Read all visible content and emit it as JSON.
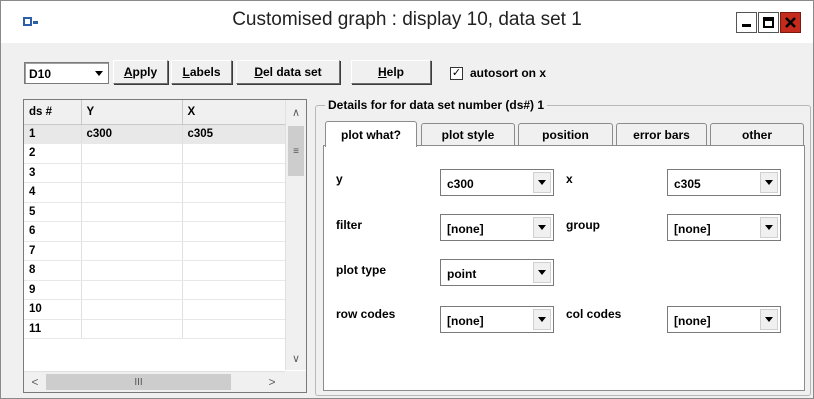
{
  "window": {
    "title": "Customised graph : display 10, data set 1",
    "controls": {
      "minimize": "▬",
      "maximize": "□",
      "close": "✕"
    }
  },
  "toolbar": {
    "display_select": "D10",
    "apply_label_u": "A",
    "apply_label_rest": "pply",
    "labels_label_u": "L",
    "labels_label_rest": "abels",
    "del_label_u": "D",
    "del_label_rest": "el data set",
    "help_label_u": "H",
    "help_label_rest": "elp",
    "autosort_checked": "✓",
    "autosort_label": "autosort on x"
  },
  "grid": {
    "headers": [
      "ds #",
      "Y",
      "X"
    ],
    "rows": [
      [
        "1",
        "c300",
        "c305"
      ],
      [
        "2",
        "",
        ""
      ],
      [
        "3",
        "",
        ""
      ],
      [
        "4",
        "",
        ""
      ],
      [
        "5",
        "",
        ""
      ],
      [
        "6",
        "",
        ""
      ],
      [
        "7",
        "",
        ""
      ],
      [
        "8",
        "",
        ""
      ],
      [
        "9",
        "",
        ""
      ],
      [
        "10",
        "",
        ""
      ],
      [
        "11",
        "",
        ""
      ]
    ],
    "scroll": {
      "up": "∧",
      "down": "∨",
      "left": "<",
      "right": ">",
      "thumb_h": "III",
      "thumb_v": "≡"
    }
  },
  "details": {
    "legend": "Details for for data set number (ds#) 1",
    "tabs": [
      "plot what?",
      "plot style",
      "position",
      "error bars",
      "other"
    ],
    "fields": {
      "y_label": "y",
      "y_value": "c300",
      "x_label": "x",
      "x_value": "c305",
      "filter_label": "filter",
      "filter_value": "[none]",
      "group_label": "group",
      "group_value": "[none]",
      "plot_type_label": "plot type",
      "plot_type_value": "point",
      "row_codes_label": "row codes",
      "row_codes_value": "[none]",
      "col_codes_label": "col codes",
      "col_codes_value": "[none]"
    }
  },
  "colors": {
    "close_button": "#c42b1c",
    "window_bg": "#f0f0f0"
  }
}
